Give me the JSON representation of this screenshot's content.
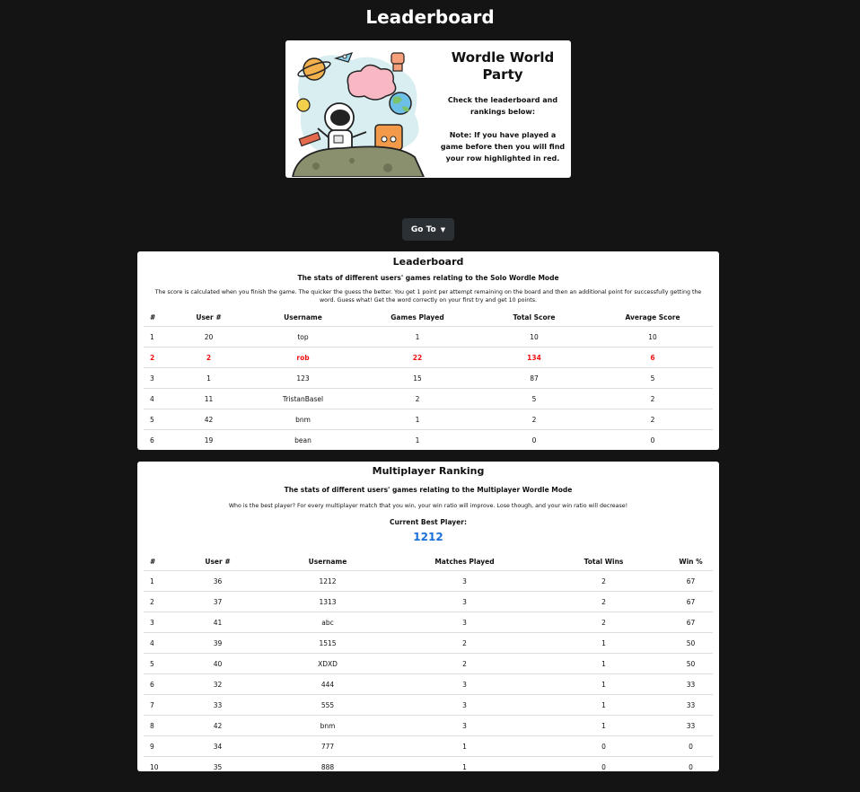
{
  "page": {
    "title": "Leaderboard"
  },
  "hero": {
    "heading": "Wordle World Party",
    "description": "Check the leaderboard and rankings below:",
    "note": "Note: If you have played a game before then you will find your row highlighted in red."
  },
  "nav": {
    "goto_label": "Go To"
  },
  "solo": {
    "title": "Leaderboard",
    "subtitle": "The stats of different users' games relating to the Solo Wordle Mode",
    "description": "The score is calculated when you finish the game. The quicker the guess the better. You get 1 point per attempt remaining on the board and then an additional point for successfully getting the word. Guess what! Get the word correctly on your first try and get 10 points.",
    "columns": [
      "#",
      "User #",
      "Username",
      "Games Played",
      "Total Score",
      "Average Score"
    ],
    "rows": [
      [
        "1",
        "20",
        "top",
        "1",
        "10",
        "10"
      ],
      [
        "2",
        "2",
        "rob",
        "22",
        "134",
        "6"
      ],
      [
        "3",
        "1",
        "123",
        "15",
        "87",
        "5"
      ],
      [
        "4",
        "11",
        "TristanBasel",
        "2",
        "5",
        "2"
      ],
      [
        "5",
        "42",
        "bnm",
        "1",
        "2",
        "2"
      ],
      [
        "6",
        "19",
        "bean",
        "1",
        "0",
        "0"
      ]
    ],
    "highlight_row_index": 1,
    "highlight_color": "#e11111"
  },
  "multi": {
    "title": "Multiplayer Ranking",
    "subtitle": "The stats of different users' games relating to the Multiplayer Wordle Mode",
    "description": "Who is the best player? For every multiplayer match that you win, your win ratio will improve. Lose though, and your win ratio will decrease!",
    "best_label": "Current Best Player:",
    "best_player": "1212",
    "best_color": "#1a6fd8",
    "columns": [
      "#",
      "User #",
      "Username",
      "Matches Played",
      "Total Wins",
      "Win %"
    ],
    "rows": [
      [
        "1",
        "36",
        "1212",
        "3",
        "2",
        "67"
      ],
      [
        "2",
        "37",
        "1313",
        "3",
        "2",
        "67"
      ],
      [
        "3",
        "41",
        "abc",
        "3",
        "2",
        "67"
      ],
      [
        "4",
        "39",
        "1515",
        "2",
        "1",
        "50"
      ],
      [
        "5",
        "40",
        "XDXD",
        "2",
        "1",
        "50"
      ],
      [
        "6",
        "32",
        "444",
        "3",
        "1",
        "33"
      ],
      [
        "7",
        "33",
        "555",
        "3",
        "1",
        "33"
      ],
      [
        "8",
        "42",
        "bnm",
        "3",
        "1",
        "33"
      ],
      [
        "9",
        "34",
        "777",
        "1",
        "0",
        "0"
      ],
      [
        "10",
        "35",
        "888",
        "1",
        "0",
        "0"
      ]
    ]
  },
  "colors": {
    "background": "#141414",
    "card": "#ffffff",
    "button": "#2b3035"
  }
}
